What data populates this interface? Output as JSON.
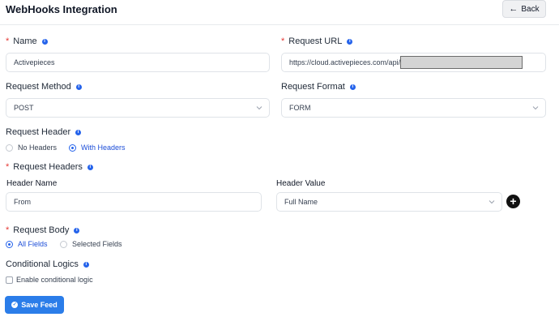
{
  "header": {
    "title": "WebHooks Integration",
    "back_label": "Back",
    "back_icon": "arrow-left-icon"
  },
  "form": {
    "name": {
      "label": "Name",
      "required": "*",
      "value": "Activepieces"
    },
    "request_url": {
      "label": "Request URL",
      "required": "*",
      "value": "https://cloud.activepieces.com/api/"
    },
    "request_method": {
      "label": "Request Method",
      "value": "POST"
    },
    "request_format": {
      "label": "Request Format",
      "value": "FORM"
    },
    "request_header": {
      "label": "Request Header",
      "options": [
        {
          "label": "No Headers",
          "selected": false
        },
        {
          "label": "With Headers",
          "selected": true
        }
      ]
    },
    "request_headers": {
      "label": "Request Headers",
      "required": "*",
      "name_col": "Header Name",
      "value_col": "Header Value",
      "rows": [
        {
          "name": "From",
          "value": "Full Name"
        }
      ]
    },
    "request_body": {
      "label": "Request Body",
      "required": "*",
      "options": [
        {
          "label": "All Fields",
          "selected": true
        },
        {
          "label": "Selected Fields",
          "selected": false
        }
      ]
    },
    "conditional_logics": {
      "label": "Conditional Logics",
      "checkbox_label": "Enable conditional logic",
      "checked": false
    },
    "save_label": "Save Feed"
  },
  "colors": {
    "accent": "#2563eb",
    "save_button": "#2b7de9",
    "required": "#e53935"
  }
}
